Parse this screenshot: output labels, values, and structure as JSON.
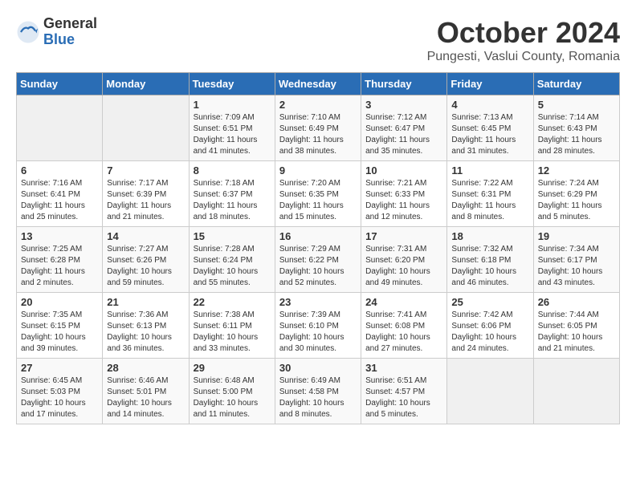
{
  "header": {
    "logo_general": "General",
    "logo_blue": "Blue",
    "month_title": "October 2024",
    "subtitle": "Pungesti, Vaslui County, Romania"
  },
  "days_of_week": [
    "Sunday",
    "Monday",
    "Tuesday",
    "Wednesday",
    "Thursday",
    "Friday",
    "Saturday"
  ],
  "weeks": [
    [
      {
        "day": "",
        "info": ""
      },
      {
        "day": "",
        "info": ""
      },
      {
        "day": "1",
        "info": "Sunrise: 7:09 AM\nSunset: 6:51 PM\nDaylight: 11 hours and 41 minutes."
      },
      {
        "day": "2",
        "info": "Sunrise: 7:10 AM\nSunset: 6:49 PM\nDaylight: 11 hours and 38 minutes."
      },
      {
        "day": "3",
        "info": "Sunrise: 7:12 AM\nSunset: 6:47 PM\nDaylight: 11 hours and 35 minutes."
      },
      {
        "day": "4",
        "info": "Sunrise: 7:13 AM\nSunset: 6:45 PM\nDaylight: 11 hours and 31 minutes."
      },
      {
        "day": "5",
        "info": "Sunrise: 7:14 AM\nSunset: 6:43 PM\nDaylight: 11 hours and 28 minutes."
      }
    ],
    [
      {
        "day": "6",
        "info": "Sunrise: 7:16 AM\nSunset: 6:41 PM\nDaylight: 11 hours and 25 minutes."
      },
      {
        "day": "7",
        "info": "Sunrise: 7:17 AM\nSunset: 6:39 PM\nDaylight: 11 hours and 21 minutes."
      },
      {
        "day": "8",
        "info": "Sunrise: 7:18 AM\nSunset: 6:37 PM\nDaylight: 11 hours and 18 minutes."
      },
      {
        "day": "9",
        "info": "Sunrise: 7:20 AM\nSunset: 6:35 PM\nDaylight: 11 hours and 15 minutes."
      },
      {
        "day": "10",
        "info": "Sunrise: 7:21 AM\nSunset: 6:33 PM\nDaylight: 11 hours and 12 minutes."
      },
      {
        "day": "11",
        "info": "Sunrise: 7:22 AM\nSunset: 6:31 PM\nDaylight: 11 hours and 8 minutes."
      },
      {
        "day": "12",
        "info": "Sunrise: 7:24 AM\nSunset: 6:29 PM\nDaylight: 11 hours and 5 minutes."
      }
    ],
    [
      {
        "day": "13",
        "info": "Sunrise: 7:25 AM\nSunset: 6:28 PM\nDaylight: 11 hours and 2 minutes."
      },
      {
        "day": "14",
        "info": "Sunrise: 7:27 AM\nSunset: 6:26 PM\nDaylight: 10 hours and 59 minutes."
      },
      {
        "day": "15",
        "info": "Sunrise: 7:28 AM\nSunset: 6:24 PM\nDaylight: 10 hours and 55 minutes."
      },
      {
        "day": "16",
        "info": "Sunrise: 7:29 AM\nSunset: 6:22 PM\nDaylight: 10 hours and 52 minutes."
      },
      {
        "day": "17",
        "info": "Sunrise: 7:31 AM\nSunset: 6:20 PM\nDaylight: 10 hours and 49 minutes."
      },
      {
        "day": "18",
        "info": "Sunrise: 7:32 AM\nSunset: 6:18 PM\nDaylight: 10 hours and 46 minutes."
      },
      {
        "day": "19",
        "info": "Sunrise: 7:34 AM\nSunset: 6:17 PM\nDaylight: 10 hours and 43 minutes."
      }
    ],
    [
      {
        "day": "20",
        "info": "Sunrise: 7:35 AM\nSunset: 6:15 PM\nDaylight: 10 hours and 39 minutes."
      },
      {
        "day": "21",
        "info": "Sunrise: 7:36 AM\nSunset: 6:13 PM\nDaylight: 10 hours and 36 minutes."
      },
      {
        "day": "22",
        "info": "Sunrise: 7:38 AM\nSunset: 6:11 PM\nDaylight: 10 hours and 33 minutes."
      },
      {
        "day": "23",
        "info": "Sunrise: 7:39 AM\nSunset: 6:10 PM\nDaylight: 10 hours and 30 minutes."
      },
      {
        "day": "24",
        "info": "Sunrise: 7:41 AM\nSunset: 6:08 PM\nDaylight: 10 hours and 27 minutes."
      },
      {
        "day": "25",
        "info": "Sunrise: 7:42 AM\nSunset: 6:06 PM\nDaylight: 10 hours and 24 minutes."
      },
      {
        "day": "26",
        "info": "Sunrise: 7:44 AM\nSunset: 6:05 PM\nDaylight: 10 hours and 21 minutes."
      }
    ],
    [
      {
        "day": "27",
        "info": "Sunrise: 6:45 AM\nSunset: 5:03 PM\nDaylight: 10 hours and 17 minutes."
      },
      {
        "day": "28",
        "info": "Sunrise: 6:46 AM\nSunset: 5:01 PM\nDaylight: 10 hours and 14 minutes."
      },
      {
        "day": "29",
        "info": "Sunrise: 6:48 AM\nSunset: 5:00 PM\nDaylight: 10 hours and 11 minutes."
      },
      {
        "day": "30",
        "info": "Sunrise: 6:49 AM\nSunset: 4:58 PM\nDaylight: 10 hours and 8 minutes."
      },
      {
        "day": "31",
        "info": "Sunrise: 6:51 AM\nSunset: 4:57 PM\nDaylight: 10 hours and 5 minutes."
      },
      {
        "day": "",
        "info": ""
      },
      {
        "day": "",
        "info": ""
      }
    ]
  ]
}
